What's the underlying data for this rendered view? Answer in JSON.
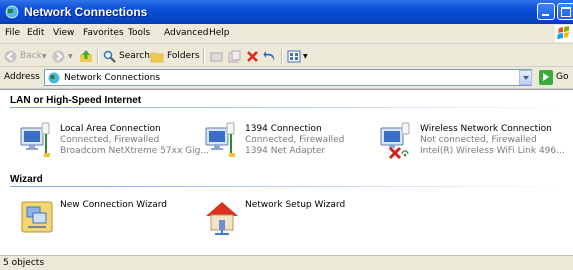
{
  "window": {
    "title": "Network Connections"
  },
  "menu": [
    "File",
    "Edit",
    "View",
    "Favorites",
    "Tools",
    "Advanced",
    "Help"
  ],
  "toolbar": {
    "back": "Back",
    "search": "Search",
    "folders": "Folders"
  },
  "address": {
    "label": "Address",
    "value": "Network Connections",
    "go": "Go"
  },
  "groups": [
    {
      "header": "LAN or High-Speed Internet",
      "items": [
        {
          "name": "Local Area Connection",
          "status": "Connected, Firewalled",
          "device": "Broadcom NetXtreme 57xx Gig..."
        },
        {
          "name": "1394 Connection",
          "status": "Connected, Firewalled",
          "device": "1394 Net Adapter"
        },
        {
          "name": "Wireless Network Connection",
          "status": "Not connected, Firewalled",
          "device": "Intel(R) Wireless WiFi Link 496..."
        }
      ]
    },
    {
      "header": "Wizard",
      "items": [
        {
          "name": "New Connection Wizard"
        },
        {
          "name": "Network Setup Wizard"
        }
      ]
    }
  ],
  "status": {
    "text": "5 objects"
  },
  "colors": {
    "titlebar": "#0a4fd6",
    "link_blue": "#7ba2e7",
    "subtext": "#7a7a7a"
  }
}
